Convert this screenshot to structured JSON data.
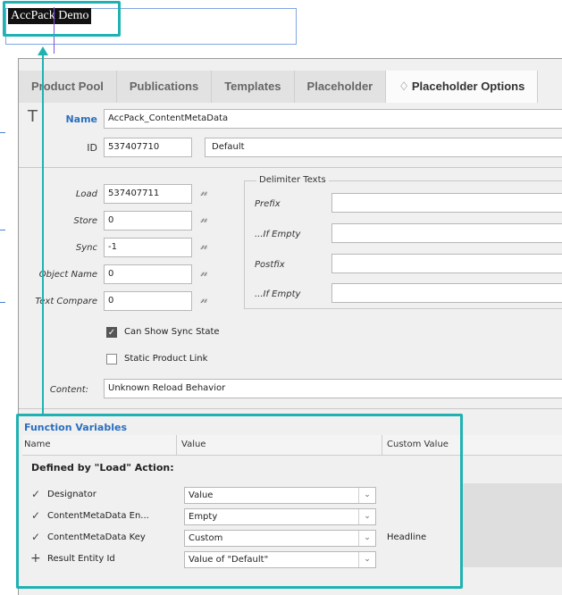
{
  "document": {
    "title": "AccPack Demo"
  },
  "tabs": [
    {
      "label": "Product Pool",
      "active": false
    },
    {
      "label": "Publications",
      "active": false
    },
    {
      "label": "Templates",
      "active": false
    },
    {
      "label": "Placeholder",
      "active": false
    },
    {
      "label": "Placeholder Options",
      "active": true,
      "icon": "♢"
    }
  ],
  "type_glyph": "T",
  "name": {
    "label": "Name",
    "value": "AccPack_ContentMetaData"
  },
  "id": {
    "label": "ID",
    "value": "537407710",
    "default": "Default"
  },
  "actions": [
    {
      "label": "Load",
      "value": "537407711"
    },
    {
      "label": "Store",
      "value": "0"
    },
    {
      "label": "Sync",
      "value": "-1"
    },
    {
      "label": "Object Name",
      "value": "0"
    },
    {
      "label": "Text Compare",
      "value": "0"
    }
  ],
  "delimiter": {
    "title": "Delimiter Texts",
    "fields": [
      {
        "label": "Prefix",
        "value": ""
      },
      {
        "label": "...If Empty",
        "value": ""
      },
      {
        "label": "Postfix",
        "value": ""
      },
      {
        "label": "...If Empty",
        "value": ""
      }
    ]
  },
  "checkboxes": [
    {
      "label": "Can Show Sync State",
      "checked": true
    },
    {
      "label": "Static Product Link",
      "checked": false
    }
  ],
  "content": {
    "label": "Content:",
    "value": "Unknown Reload Behavior"
  },
  "function_variables": {
    "title": "Function Variables",
    "columns": [
      "Name",
      "Value",
      "Custom Value"
    ],
    "group": "Defined by \"Load\" Action:",
    "rows": [
      {
        "symbol": "✓",
        "name": "Designator",
        "value": "Value",
        "custom": ""
      },
      {
        "symbol": "✓",
        "name": "ContentMetaData En...",
        "value": "Empty",
        "custom": ""
      },
      {
        "symbol": "✓",
        "name": "ContentMetaData Key",
        "value": "Custom",
        "custom": "Headline"
      },
      {
        "symbol": "+",
        "name": "Result Entity Id",
        "value": "Value of \"Default\"",
        "custom": ""
      }
    ]
  },
  "colors": {
    "highlight": "#20b2b2",
    "accent_blue": "#2a6fbf"
  },
  "icons": {
    "edit": "edit-script-icon",
    "dropdown": "chevron-down-icon"
  }
}
